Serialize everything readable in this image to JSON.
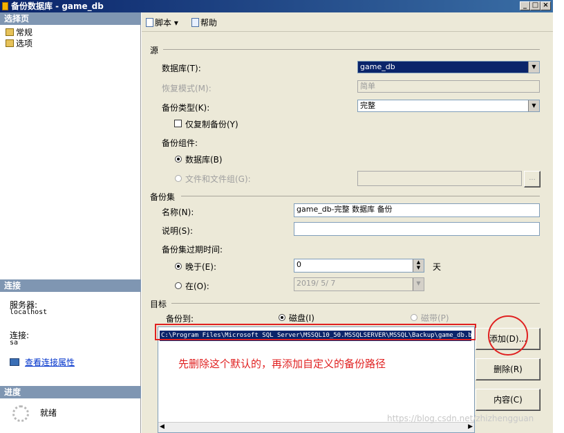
{
  "window": {
    "title": "备份数据库 - game_db",
    "min": "_",
    "max": "□",
    "close": "×"
  },
  "left_panel": {
    "select_page_header": "选择页",
    "pages": [
      {
        "label": "常规"
      },
      {
        "label": "选项"
      }
    ],
    "connection_header": "连接",
    "server_label": "服务器:",
    "server_value": "localhost",
    "connection_label": "连接:",
    "connection_value": "sa",
    "view_link": "查看连接属性",
    "progress_header": "进度",
    "progress_status": "就绪"
  },
  "toolbar": {
    "script": "脚本",
    "script_arrow": "▾",
    "help": "帮助"
  },
  "source": {
    "group_label": "源",
    "database_label": "数据库(T):",
    "database_value": "game_db",
    "recovery_label": "恢复模式(M):",
    "recovery_value": "简单",
    "backup_type_label": "备份类型(K):",
    "backup_type_value": "完整",
    "copy_only_label": "仅复制备份(Y)",
    "component_label": "备份组件:",
    "database_radio": "数据库(B)",
    "files_radio": "文件和文件组(G):",
    "browse": "..."
  },
  "backup_set": {
    "group_label": "备份集",
    "name_label": "名称(N):",
    "name_value": "game_db-完整 数据库 备份",
    "desc_label": "说明(S):",
    "desc_value": "",
    "expire_label": "备份集过期时间:",
    "after_label": "晚于(E):",
    "after_value": "0",
    "days": "天",
    "on_label": "在(O):",
    "on_value": "2019/ 5/ 7"
  },
  "destination": {
    "group_label": "目标",
    "backup_to": "备份到:",
    "disk": "磁盘(I)",
    "tape": "磁带(P)",
    "paths": [
      "C:\\Program Files\\Microsoft SQL Server\\MSSQL10_50.MSSQLSERVER\\MSSQL\\Backup\\game_db.b"
    ],
    "add": "添加(D)...",
    "remove": "删除(R)",
    "contents": "内容(C)"
  },
  "annotation": {
    "text": "先删除这个默认的，再添加自定义的备份路径",
    "color": "#e02020"
  },
  "watermark": "https://blog.csdn.net/zhizhengguan",
  "colors": {
    "title_bar": "#0a246a",
    "section_header": "#7f96b2",
    "dialog_bg": "#ece9d8",
    "highlight": "#0a246a"
  }
}
